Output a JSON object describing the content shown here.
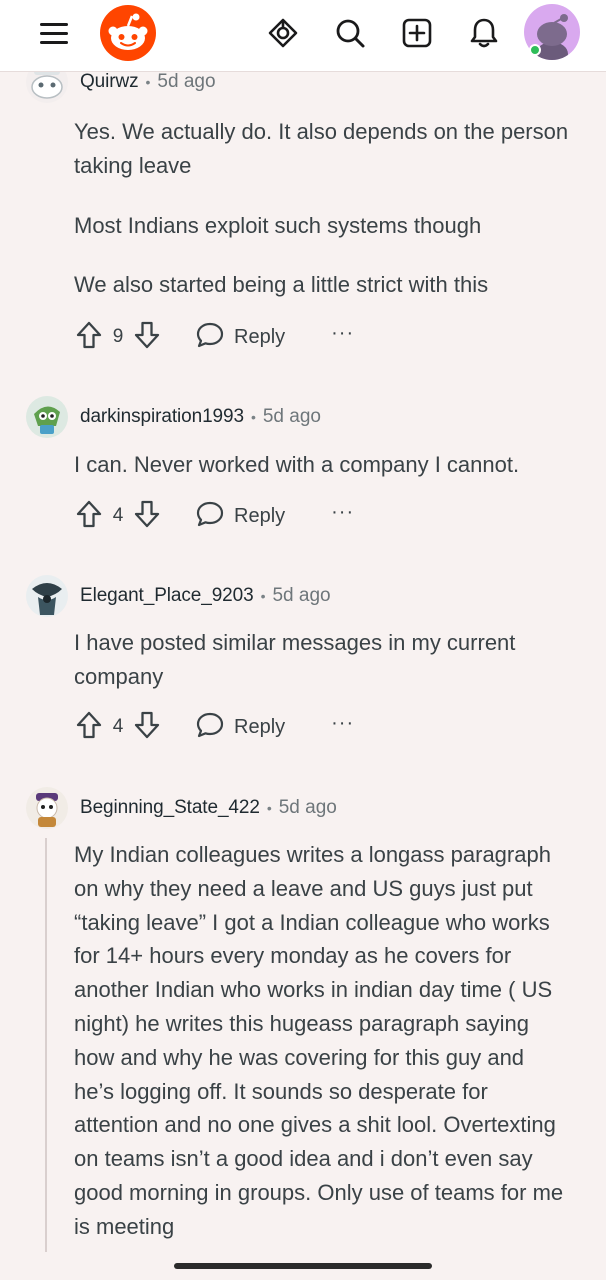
{
  "header": {
    "icons": [
      "menu-icon",
      "reddit-logo",
      "popular-icon",
      "search-icon",
      "create-post-icon",
      "notifications-icon",
      "user-avatar"
    ],
    "colors": {
      "brand": "#ff4500",
      "avatar_bg": "#d9a9ef",
      "online": "#2ebd59"
    }
  },
  "comments": [
    {
      "username": "Quirwz",
      "separator": "•",
      "time": "5d ago",
      "paragraphs": [
        "Yes. We actually do. It also depends on the person taking leave",
        "Most Indians exploit such systems though",
        "We also started being a little strict with this"
      ],
      "votes": "9",
      "reply_label": "Reply",
      "more_label": "···"
    },
    {
      "username": "darkinspiration1993",
      "separator": "•",
      "time": "5d ago",
      "paragraphs": [
        "I can. Never worked with a company I cannot."
      ],
      "votes": "4",
      "reply_label": "Reply",
      "more_label": "···"
    },
    {
      "username": "Elegant_Place_9203",
      "separator": "•",
      "time": "5d ago",
      "paragraphs": [
        "I have posted similar messages in my current company"
      ],
      "votes": "4",
      "reply_label": "Reply",
      "more_label": "···"
    },
    {
      "username": "Beginning_State_422",
      "separator": "•",
      "time": "5d ago",
      "paragraphs": [
        "My Indian colleagues writes a longass paragraph on why they need a leave and US guys just put “taking leave” I got a Indian colleague who works for 14+ hours every monday as he covers for another Indian who works in indian day time ( US night) he writes this hugeass paragraph saying how and why he was covering for this guy and he’s logging off. It sounds so desperate for attention and no one gives a shit lool. Overtexting on teams isn’t a good idea and i don’t even say good morning in groups. Only use of teams for me is meeting"
      ]
    }
  ]
}
